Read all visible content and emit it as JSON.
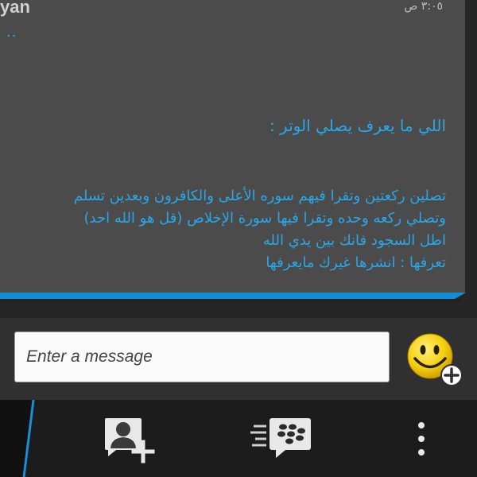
{
  "conversation": {
    "sender_partial": "yan",
    "timestamp": "٣:٠٥ ص",
    "dots": "..",
    "heading": "اللي ما يعرف يصلي الوتر :",
    "body_lines": [
      "تصلين ركعتين وتقرا فيهم سوره الأعلى والكافرون وبعدين تسلم",
      "وتصلي ركعه وحده وتقرا فيها سورة الإخلاص (قل هو الله احد)",
      "اطل السجود فانك بين يدي الله",
      "تعرفها : انشرها غيرك مايعرفها"
    ]
  },
  "composer": {
    "placeholder": "Enter a message",
    "emoji_icon": "smiley-add-icon"
  },
  "action_bar": {
    "invite_icon": "invite-contact-icon",
    "bbm_icon": "bbm-chats-icon",
    "more_icon": "overflow-menu-icon"
  },
  "colors": {
    "message_text": "#2aa7e8",
    "accent": "#0f8fd8",
    "bubble": "#4b4b4b"
  }
}
